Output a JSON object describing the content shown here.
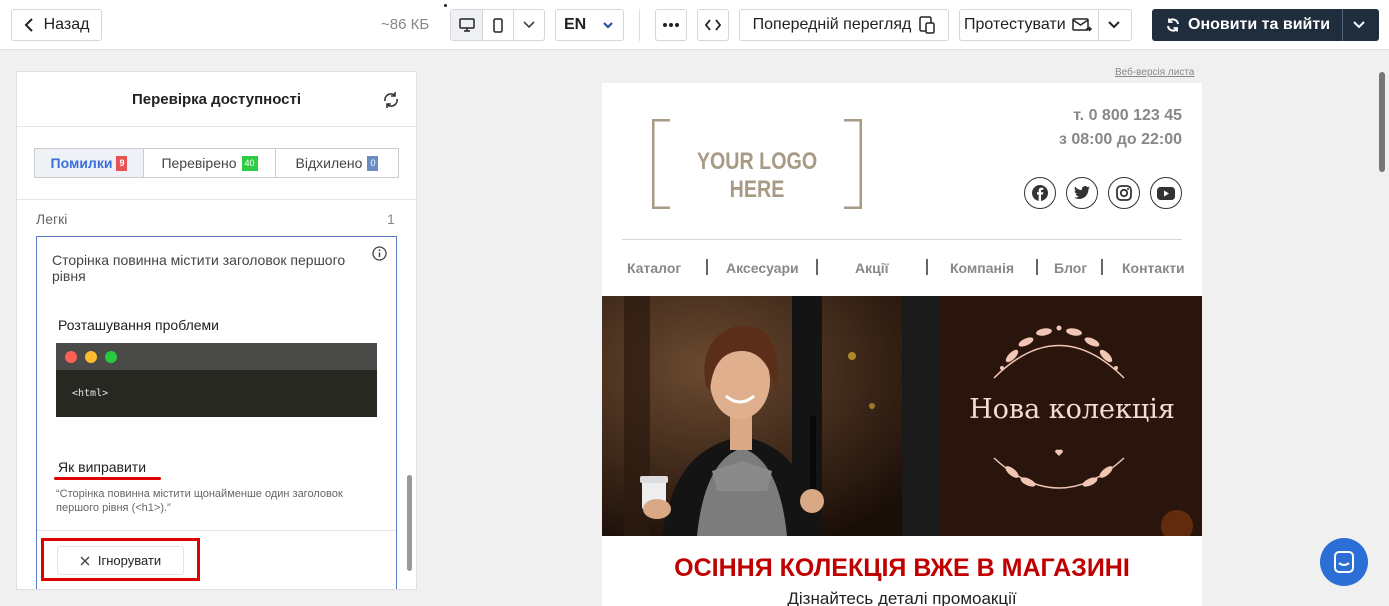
{
  "toolbar": {
    "back_label": "Назад",
    "size_label": "~86 КБ",
    "language": "EN",
    "preview_label": "Попередній перегляд",
    "test_label": "Протестувати",
    "update_label": "Оновити та вийти"
  },
  "panel": {
    "title": "Перевірка доступності",
    "tabs": [
      {
        "label": "Помилки",
        "count": "9",
        "color": "#e55353"
      },
      {
        "label": "Перевірено",
        "count": "40",
        "color": "#2ecc40"
      },
      {
        "label": "Відхилено",
        "count": "0",
        "color": "#6c8cc4"
      }
    ],
    "section": {
      "label": "Легкі",
      "count": "1"
    },
    "issue": {
      "title": "Сторінка повинна містити заголовок першого рівня",
      "location_label": "Розташування проблеми",
      "code": "<html>",
      "fix_label": "Як виправити",
      "fix_text": "“Сторінка повинна містити щонайменше один заголовок першого рівня (<h1>).”",
      "ignore_label": "Ігнорувати"
    }
  },
  "email": {
    "web_version": "Веб-версія листа",
    "logo": "YOUR LOGO HERE",
    "phone": "т. 0 800 123 45",
    "hours": "з 08:00 до 22:00",
    "nav": [
      "Каталог",
      "Аксесуари",
      "Акції",
      "Компанія",
      "Блог",
      "Контакти"
    ],
    "hero_text": "Нова колекція",
    "headline": "ОСІННЯ КОЛЕКЦІЯ ВЖЕ В МАГАЗИНІ",
    "subheadline": "Дізнайтесь деталі промоакції"
  },
  "colors": {
    "accent": "#1f2d3d",
    "headline": "#c00000",
    "highlight": "#e00000"
  }
}
